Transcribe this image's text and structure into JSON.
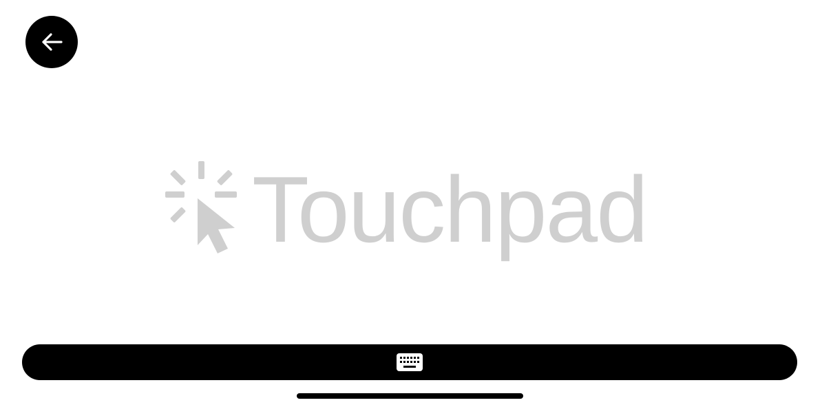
{
  "app": {
    "screen": "touchpad"
  },
  "header": {
    "back_button_icon": "arrow-left-icon"
  },
  "touchpad": {
    "watermark_icon": "pointer-click-icon",
    "watermark_text": "Touchpad",
    "watermark_color": "#cfcfcf"
  },
  "footer": {
    "keyboard_button_icon": "keyboard-icon",
    "bar_color": "#000000",
    "home_indicator_color": "#000000"
  }
}
